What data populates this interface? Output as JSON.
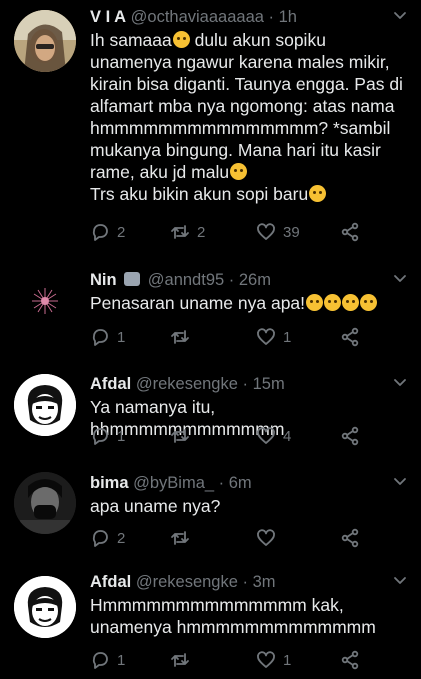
{
  "tweets": [
    {
      "name": "V I A",
      "handle": "@octhaviaaaaaaa",
      "dot": "·",
      "time": "1h",
      "lines": [
        "Ih samaaa",
        " dulu akun sopiku",
        "unamenya ngawur karena males mikir,",
        "kirain bisa diganti. Taunya engga. Pas di",
        "alfamart mba nya ngomong: atas nama",
        "hmmmmmmmmmmmmmmm? *sambil",
        "mukanya bingung. Mana hari itu kasir",
        "rame, aku jd malu",
        "Trs aku bikin akun sopi baru"
      ],
      "replies": "2",
      "retweets": "2",
      "likes": "39"
    },
    {
      "name": "Nin",
      "handle": "@anndt95",
      "dot": "·",
      "time": "26m",
      "text": "Penasaran uname nya apa!",
      "replies": "1",
      "retweets": "",
      "likes": "1"
    },
    {
      "name": "Afdal",
      "handle": "@rekesengke",
      "dot": "·",
      "time": "15m",
      "text": "Ya namanya itu, hhmmmmmmmmmmmm",
      "replies": "1",
      "retweets": "",
      "likes": "4"
    },
    {
      "name": "bima",
      "handle": "@byBima_",
      "dot": "·",
      "time": "6m",
      "text": "apa uname nya?",
      "replies": "2",
      "retweets": "",
      "likes": ""
    },
    {
      "name": "Afdal",
      "handle": "@rekesengke",
      "dot": "·",
      "time": "3m",
      "lines": [
        "Hmmmmmmmmmmmmmm kak,",
        "unamenya hmmmmmmmmmmmmm"
      ],
      "replies": "1",
      "retweets": "",
      "likes": "1"
    }
  ],
  "colors": {
    "background": "#000000",
    "text": "#e7e9ea",
    "muted": "#71767b",
    "emoji": "#f7c133"
  },
  "icons": [
    "reply-icon",
    "retweet-icon",
    "like-icon",
    "share-icon",
    "chevron-down-icon",
    "wolf-emoji-icon",
    "crying-emoji-icon"
  ]
}
